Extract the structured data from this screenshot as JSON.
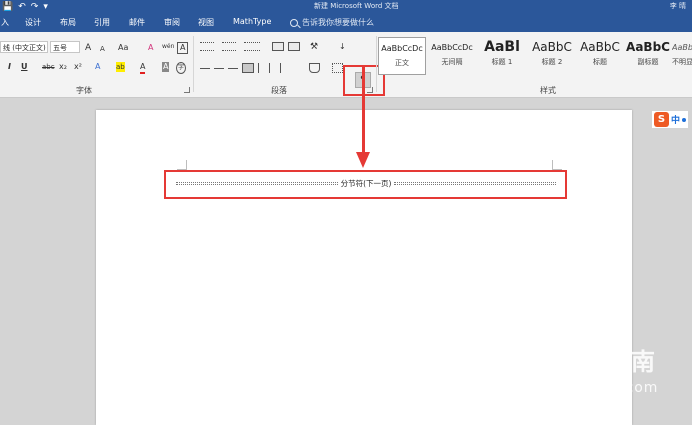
{
  "title_bar": {
    "doc_title": "新建 Microsoft Word 文档",
    "user": "李 晴",
    "qat": [
      "💾",
      "↶",
      "↷",
      "▾"
    ]
  },
  "tabs": {
    "items": [
      "入",
      "设计",
      "布局",
      "引用",
      "邮件",
      "审阅",
      "视图",
      "MathType"
    ],
    "tell_me": "告诉我你想要做什么"
  },
  "ribbon": {
    "font": {
      "font_name": "线 (中文正文)",
      "font_size": "五号",
      "label": "字体",
      "grow": "A",
      "shrink": "A",
      "case": "Aa",
      "clear": "A",
      "pinyin": "wén",
      "border_char": "A",
      "italic": "I",
      "underline": "U",
      "strike": "abc",
      "subscript": "x₂",
      "superscript": "x²",
      "effects": "A",
      "highlight": "ab",
      "font_color": "A",
      "shading": "A",
      "enclose": "字"
    },
    "paragraph": {
      "label": "段落",
      "sort": "↓",
      "show_marks": "¶"
    },
    "styles": {
      "label": "样式",
      "items": [
        {
          "preview": "AaBbCcDc",
          "label": "正文"
        },
        {
          "preview": "AaBbCcDc",
          "label": "无间隔"
        },
        {
          "preview": "AaBl",
          "label": "标题 1"
        },
        {
          "preview": "AaBbC",
          "label": "标题 2"
        },
        {
          "preview": "AaBbC",
          "label": "标题"
        },
        {
          "preview": "AaBbC",
          "label": "副标题"
        },
        {
          "preview": "AaBb",
          "label": "不明显"
        }
      ]
    }
  },
  "document": {
    "section_break_text": "分节符(下一页)"
  },
  "ime": {
    "logo": "S",
    "mode": "中"
  },
  "watermark": {
    "logo": "S",
    "text": "搜狗指南",
    "url": "zhinan.sogou.com"
  }
}
